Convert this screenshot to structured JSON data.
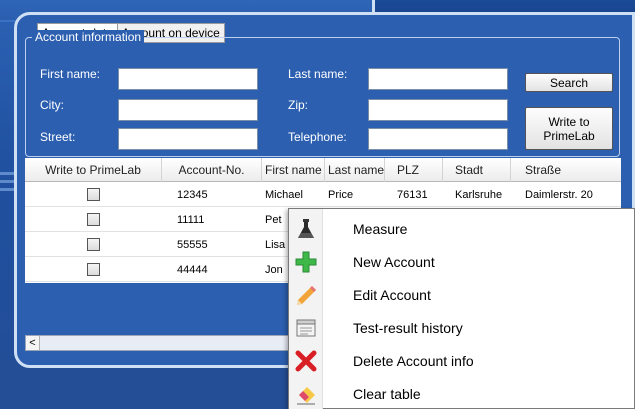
{
  "tabs": [
    {
      "label": "Account-data",
      "active": true
    },
    {
      "label": "Account on device",
      "active": false
    }
  ],
  "account_info": {
    "legend": "Account information",
    "fields": {
      "first_name": {
        "label": "First name:",
        "value": ""
      },
      "city": {
        "label": "City:",
        "value": ""
      },
      "street": {
        "label": "Street:",
        "value": ""
      },
      "last_name": {
        "label": "Last name:",
        "value": ""
      },
      "zip": {
        "label": "Zip:",
        "value": ""
      },
      "telephone": {
        "label": "Telephone:",
        "value": ""
      }
    },
    "search_button": "Search",
    "write_button_line1": "Write to",
    "write_button_line2": "PrimeLab"
  },
  "table": {
    "columns": [
      "Write to PrimeLab",
      "Account-No.",
      "First name",
      "Last name",
      "PLZ",
      "Stadt",
      "Straße"
    ],
    "rows": [
      {
        "checked": false,
        "account_no": "12345",
        "first_name": "Michael",
        "last_name": "Price",
        "plz": "76131",
        "stadt": "Karlsruhe",
        "strasse": "Daimlerstr. 20"
      },
      {
        "checked": false,
        "account_no": "11111",
        "first_name": "Pet",
        "last_name": "",
        "plz": "",
        "stadt": "",
        "strasse": ""
      },
      {
        "checked": false,
        "account_no": "55555",
        "first_name": "Lisa",
        "last_name": "",
        "plz": "",
        "stadt": "",
        "strasse": ""
      },
      {
        "checked": false,
        "account_no": "44444",
        "first_name": "Jon",
        "last_name": "",
        "plz": "",
        "stadt": "",
        "strasse": ""
      }
    ]
  },
  "scrollbar": {
    "left_arrow": "<"
  },
  "context_menu": {
    "items": [
      {
        "label": "Measure",
        "icon": "flask-icon"
      },
      {
        "label": "New Account",
        "icon": "plus-icon"
      },
      {
        "label": "Edit Account",
        "icon": "pencil-icon"
      },
      {
        "label": "Test-result history",
        "icon": "history-icon"
      },
      {
        "label": "Delete Account info",
        "icon": "delete-icon"
      },
      {
        "label": "Clear table",
        "icon": "eraser-icon"
      }
    ]
  },
  "colors": {
    "background": "#2c5fb0",
    "panel_border": "#cfe0f5",
    "plus_icon": "#3fb84a",
    "delete_icon": "#d91f26"
  }
}
